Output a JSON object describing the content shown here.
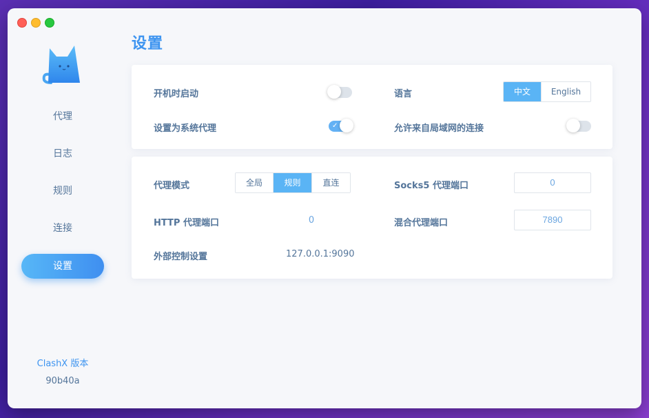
{
  "app": {
    "name": "ClashX"
  },
  "sidebar": {
    "items": [
      {
        "label": "代理",
        "active": false
      },
      {
        "label": "日志",
        "active": false
      },
      {
        "label": "规则",
        "active": false
      },
      {
        "label": "连接",
        "active": false
      },
      {
        "label": "设置",
        "active": true
      }
    ],
    "version_label": "ClashX 版本",
    "version_value": "90b40a"
  },
  "page": {
    "title": "设置"
  },
  "general": {
    "start_at_login": {
      "label": "开机时启动",
      "enabled": false
    },
    "system_proxy": {
      "label": "设置为系统代理",
      "enabled": true
    },
    "language": {
      "label": "语言",
      "options": [
        "中文",
        "English"
      ],
      "selected": "中文"
    },
    "allow_lan": {
      "label": "允许来自局域网的连接",
      "enabled": false
    }
  },
  "proxy": {
    "mode": {
      "label": "代理模式",
      "options": [
        "全局",
        "规则",
        "直连"
      ],
      "selected": "规则"
    },
    "socks5_port": {
      "label": "Socks5 代理端口",
      "value": "0"
    },
    "http_port": {
      "label": "HTTP 代理端口",
      "value": "0"
    },
    "mixed_port": {
      "label": "混合代理端口",
      "value": "7890"
    },
    "external_controller": {
      "label": "外部控制设置",
      "value": "127.0.0.1:9090"
    }
  },
  "colors": {
    "accent": "#3d94f0",
    "text": "#54759a",
    "toggle_on": "#63b1f4"
  },
  "icons": {
    "logo": "cat-logo-icon",
    "check": "check-icon"
  }
}
